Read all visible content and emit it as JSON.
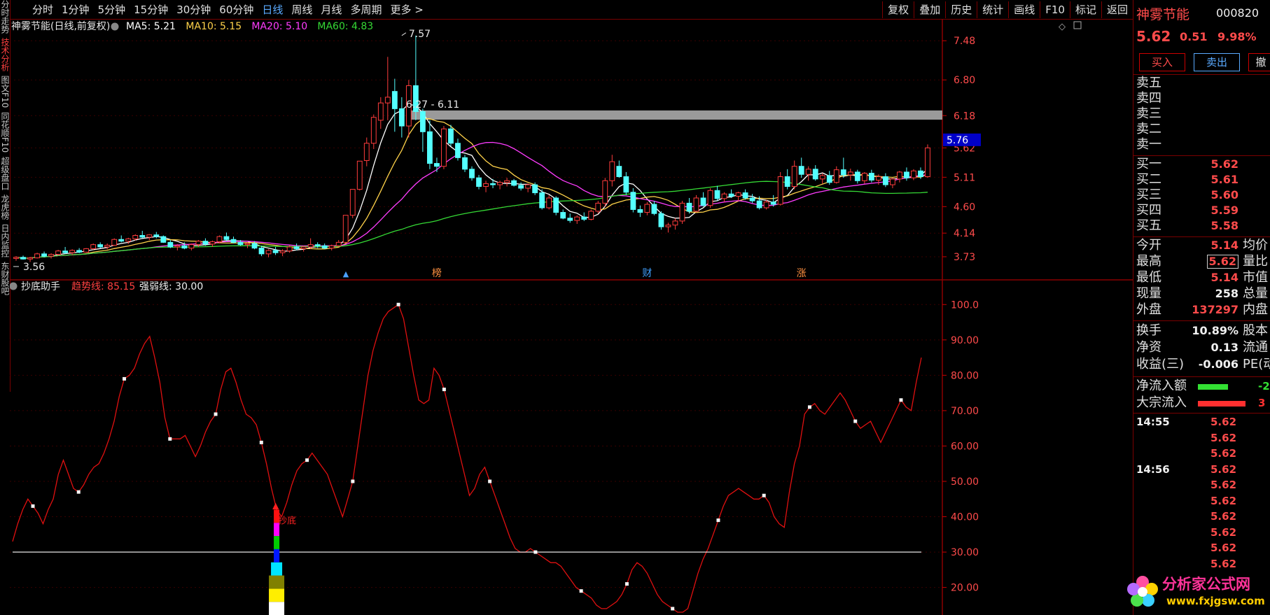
{
  "toolbar": {
    "periods": [
      "分时",
      "1分钟",
      "5分钟",
      "15分钟",
      "30分钟",
      "60分钟",
      "日线",
      "周线",
      "月线",
      "多周期",
      "更多 >"
    ],
    "active_period": "日线",
    "tools": [
      "复权",
      "叠加",
      "历史",
      "统计",
      "画线",
      "F10",
      "标记",
      "返回"
    ]
  },
  "side_tabs": [
    "分时走势",
    "技术分析",
    "图文F10",
    "同花顺F10",
    "超级盘口",
    "龙虎榜",
    "日内监控",
    "东财股吧"
  ],
  "header": {
    "stock_title": "神雾节能(日线,前复权)",
    "ma": [
      {
        "label": "MA5: 5.21",
        "color": "#ffffff"
      },
      {
        "label": "MA10: 5.15",
        "color": "#ffd24a"
      },
      {
        "label": "MA20: 5.10",
        "color": "#ff3cff"
      },
      {
        "label": "MA60: 4.83",
        "color": "#35d935"
      }
    ]
  },
  "indicator_header": {
    "name": "抄底助手",
    "trend": "趋势线: 85.15",
    "strength": "强弱线: 30.00"
  },
  "chart_data": [
    {
      "type": "candlestick",
      "title": "神雾节能(日线,前复权)",
      "ylim": [
        3.45,
        7.75
      ],
      "y_ticks": [
        7.48,
        6.8,
        6.18,
        5.62,
        5.11,
        4.6,
        4.14,
        3.73
      ],
      "current_price_label": "5.76",
      "annotations": [
        {
          "text": "7.57",
          "index": 55,
          "price": 7.57
        },
        {
          "text": "6.27 - 6.11",
          "index": 56,
          "price": 6.27
        },
        {
          "text": "3.56",
          "index": 0,
          "price": 3.56
        }
      ],
      "resistance_band": {
        "from": 6.11,
        "to": 6.27,
        "start_index": 56
      },
      "event_markers": [
        {
          "text": "榜",
          "index": 60,
          "color": "#ff9040"
        },
        {
          "text": "财",
          "index": 90,
          "color": "#40a0ff"
        },
        {
          "text": "涨",
          "index": 112,
          "color": "#ff9040"
        }
      ],
      "candles": [
        [
          3.7,
          3.74,
          3.66,
          3.72
        ],
        [
          3.72,
          3.75,
          3.68,
          3.69
        ],
        [
          3.69,
          3.73,
          3.64,
          3.71
        ],
        [
          3.71,
          3.8,
          3.7,
          3.78
        ],
        [
          3.78,
          3.82,
          3.72,
          3.74
        ],
        [
          3.74,
          3.79,
          3.7,
          3.77
        ],
        [
          3.77,
          3.85,
          3.75,
          3.83
        ],
        [
          3.83,
          3.9,
          3.78,
          3.8
        ],
        [
          3.8,
          3.86,
          3.76,
          3.84
        ],
        [
          3.84,
          3.88,
          3.79,
          3.81
        ],
        [
          3.81,
          3.88,
          3.8,
          3.87
        ],
        [
          3.87,
          3.96,
          3.85,
          3.94
        ],
        [
          3.94,
          3.98,
          3.88,
          3.9
        ],
        [
          3.9,
          3.96,
          3.86,
          3.93
        ],
        [
          3.93,
          4.05,
          3.92,
          4.03
        ],
        [
          4.03,
          4.1,
          3.98,
          4.0
        ],
        [
          4.0,
          4.06,
          3.95,
          4.04
        ],
        [
          4.04,
          4.12,
          4.01,
          4.1
        ],
        [
          4.1,
          4.18,
          4.05,
          4.07
        ],
        [
          4.07,
          4.12,
          4.02,
          4.11
        ],
        [
          4.11,
          4.16,
          4.05,
          4.08
        ],
        [
          4.08,
          4.1,
          3.97,
          3.98
        ],
        [
          3.98,
          4.02,
          3.88,
          3.9
        ],
        [
          3.9,
          3.95,
          3.84,
          3.92
        ],
        [
          3.92,
          3.98,
          3.86,
          3.88
        ],
        [
          3.88,
          3.96,
          3.84,
          3.94
        ],
        [
          3.94,
          4.02,
          3.9,
          4.0
        ],
        [
          4.0,
          4.05,
          3.92,
          3.95
        ],
        [
          3.95,
          4.01,
          3.9,
          3.99
        ],
        [
          3.99,
          4.1,
          3.96,
          4.08
        ],
        [
          4.08,
          4.15,
          4.0,
          4.03
        ],
        [
          4.03,
          4.08,
          3.96,
          3.98
        ],
        [
          3.98,
          4.02,
          3.92,
          3.94
        ],
        [
          3.94,
          3.98,
          3.88,
          3.96
        ],
        [
          3.96,
          4.0,
          3.86,
          3.88
        ],
        [
          3.88,
          3.92,
          3.74,
          3.78
        ],
        [
          3.78,
          3.86,
          3.72,
          3.84
        ],
        [
          3.84,
          3.9,
          3.76,
          3.8
        ],
        [
          3.8,
          3.86,
          3.74,
          3.83
        ],
        [
          3.83,
          3.93,
          3.8,
          3.9
        ],
        [
          3.9,
          3.96,
          3.84,
          3.87
        ],
        [
          3.87,
          3.92,
          3.82,
          3.9
        ],
        [
          3.9,
          4.05,
          3.86,
          3.94
        ],
        [
          3.94,
          3.98,
          3.88,
          3.92
        ],
        [
          3.92,
          3.96,
          3.86,
          3.88
        ],
        [
          3.88,
          3.94,
          3.84,
          3.92
        ],
        [
          3.92,
          4.02,
          3.9,
          3.98
        ],
        [
          3.98,
          4.45,
          3.97,
          4.45
        ],
        [
          4.45,
          4.9,
          4.4,
          4.9
        ],
        [
          4.9,
          5.39,
          4.88,
          5.39
        ],
        [
          5.4,
          5.8,
          5.3,
          5.7
        ],
        [
          5.7,
          6.2,
          5.6,
          6.15
        ],
        [
          6.1,
          6.5,
          5.95,
          6.4
        ],
        [
          6.4,
          7.2,
          6.1,
          6.5
        ],
        [
          6.6,
          6.82,
          5.9,
          6.3
        ],
        [
          6.3,
          6.5,
          5.8,
          6.0
        ],
        [
          6.0,
          6.8,
          5.8,
          6.7
        ],
        [
          6.7,
          7.57,
          6.1,
          6.25
        ],
        [
          6.25,
          6.3,
          5.55,
          5.9
        ],
        [
          5.9,
          6.1,
          5.25,
          5.35
        ],
        [
          5.35,
          5.45,
          5.2,
          5.3
        ],
        [
          5.3,
          6.0,
          5.25,
          5.95
        ],
        [
          5.95,
          6.02,
          5.65,
          5.7
        ],
        [
          5.7,
          5.78,
          5.4,
          5.45
        ],
        [
          5.45,
          5.5,
          5.2,
          5.25
        ],
        [
          5.25,
          5.3,
          5.05,
          5.1
        ],
        [
          5.1,
          5.15,
          4.9,
          4.95
        ],
        [
          4.95,
          5.05,
          4.85,
          5.0
        ],
        [
          5.0,
          5.08,
          4.92,
          4.98
        ],
        [
          4.98,
          5.05,
          4.9,
          5.02
        ],
        [
          5.02,
          5.1,
          4.95,
          5.05
        ],
        [
          5.05,
          5.08,
          4.95,
          4.97
        ],
        [
          4.97,
          5.02,
          4.88,
          4.92
        ],
        [
          4.92,
          5.0,
          4.85,
          4.98
        ],
        [
          4.98,
          5.02,
          4.8,
          4.84
        ],
        [
          4.84,
          4.9,
          4.55,
          4.58
        ],
        [
          4.58,
          4.8,
          4.55,
          4.75
        ],
        [
          4.75,
          4.78,
          4.45,
          4.5
        ],
        [
          4.5,
          4.55,
          4.38,
          4.4
        ],
        [
          4.4,
          4.48,
          4.32,
          4.36
        ],
        [
          4.36,
          4.45,
          4.3,
          4.42
        ],
        [
          4.42,
          4.5,
          4.35,
          4.38
        ],
        [
          4.38,
          4.55,
          4.36,
          4.52
        ],
        [
          4.52,
          4.7,
          4.48,
          4.66
        ],
        [
          4.66,
          5.1,
          4.6,
          5.05
        ],
        [
          5.05,
          5.5,
          4.95,
          5.38
        ],
        [
          5.3,
          5.4,
          5.1,
          5.12
        ],
        [
          5.12,
          5.2,
          4.8,
          4.85
        ],
        [
          4.85,
          4.92,
          4.5,
          4.55
        ],
        [
          4.55,
          4.62,
          4.42,
          4.5
        ],
        [
          4.5,
          4.68,
          4.45,
          4.64
        ],
        [
          4.64,
          4.7,
          4.45,
          4.48
        ],
        [
          4.48,
          4.52,
          4.2,
          4.25
        ],
        [
          4.25,
          4.32,
          4.15,
          4.28
        ],
        [
          4.28,
          4.4,
          4.2,
          4.35
        ],
        [
          4.35,
          4.7,
          4.3,
          4.66
        ],
        [
          4.66,
          4.75,
          4.48,
          4.52
        ],
        [
          4.52,
          4.8,
          4.5,
          4.75
        ],
        [
          4.75,
          4.85,
          4.6,
          4.62
        ],
        [
          4.62,
          4.92,
          4.58,
          4.88
        ],
        [
          4.88,
          4.96,
          4.7,
          4.74
        ],
        [
          4.74,
          4.85,
          4.68,
          4.82
        ],
        [
          4.82,
          4.9,
          4.75,
          4.78
        ],
        [
          4.78,
          4.86,
          4.7,
          4.84
        ],
        [
          4.84,
          4.9,
          4.72,
          4.75
        ],
        [
          4.75,
          4.82,
          4.66,
          4.7
        ],
        [
          4.7,
          4.78,
          4.55,
          4.58
        ],
        [
          4.58,
          4.72,
          4.55,
          4.68
        ],
        [
          4.68,
          4.8,
          4.6,
          4.64
        ],
        [
          4.64,
          5.2,
          4.62,
          5.12
        ],
        [
          5.12,
          5.25,
          4.9,
          4.95
        ],
        [
          4.95,
          5.4,
          4.9,
          5.3
        ],
        [
          5.3,
          5.45,
          5.1,
          5.16
        ],
        [
          5.16,
          5.3,
          5.05,
          5.25
        ],
        [
          5.25,
          5.32,
          5.05,
          5.08
        ],
        [
          5.08,
          5.18,
          5.0,
          5.14
        ],
        [
          5.14,
          5.22,
          4.98,
          5.02
        ],
        [
          5.02,
          5.3,
          5.0,
          5.24
        ],
        [
          5.24,
          5.45,
          5.1,
          5.15
        ],
        [
          5.15,
          5.26,
          5.05,
          5.2
        ],
        [
          5.2,
          5.24,
          5.0,
          5.05
        ],
        [
          5.05,
          5.2,
          5.0,
          5.18
        ],
        [
          5.18,
          5.24,
          5.02,
          5.06
        ],
        [
          5.06,
          5.16,
          4.98,
          5.12
        ],
        [
          5.12,
          5.18,
          4.94,
          4.98
        ],
        [
          4.98,
          5.1,
          4.92,
          5.08
        ],
        [
          5.08,
          5.22,
          5.02,
          5.2
        ],
        [
          5.2,
          5.28,
          5.05,
          5.1
        ],
        [
          5.1,
          5.25,
          5.06,
          5.22
        ],
        [
          5.22,
          5.28,
          5.08,
          5.12
        ],
        [
          5.12,
          5.68,
          5.1,
          5.62
        ]
      ]
    },
    {
      "type": "line",
      "title": "抄底助手",
      "ylim": [
        13,
        105
      ],
      "y_ticks": [
        100.0,
        90.0,
        80.0,
        70.0,
        60.0,
        50.0,
        40.0,
        30.0,
        20.0
      ],
      "series": [
        {
          "name": "趋势线",
          "color": "#e01010",
          "values": [
            33,
            38,
            42,
            45,
            43,
            41,
            38,
            42,
            45,
            52,
            56,
            52,
            48,
            47,
            49,
            52,
            54,
            55,
            58,
            62,
            67,
            74,
            79,
            80,
            82,
            86,
            89,
            91,
            85,
            78,
            68,
            62,
            62,
            62,
            63,
            60,
            57,
            60,
            64,
            67,
            69,
            76,
            81,
            82,
            78,
            73,
            69,
            68,
            66,
            61,
            55,
            48,
            42,
            40,
            44,
            49,
            53,
            55,
            56,
            58,
            56,
            54,
            52,
            48,
            44,
            40,
            45,
            50,
            60,
            70,
            80,
            87,
            92,
            96,
            98,
            99,
            100,
            96,
            88,
            80,
            73,
            72,
            73,
            82,
            80,
            76,
            70,
            64,
            58,
            52,
            46,
            48,
            52,
            54,
            50,
            46,
            42,
            38,
            34,
            31,
            30,
            30,
            31,
            30,
            29,
            28,
            27,
            27,
            26,
            24,
            22,
            20,
            19,
            18,
            17,
            15,
            14,
            14,
            15,
            16,
            18,
            21,
            25,
            27,
            26,
            24,
            21,
            18,
            16,
            15,
            14,
            13,
            13,
            14,
            19,
            24,
            28,
            31,
            35,
            39,
            43,
            46,
            47,
            48,
            47,
            46,
            45,
            45,
            46,
            44,
            40,
            38,
            37,
            47,
            55,
            60,
            69,
            71,
            72,
            70,
            69,
            71,
            73,
            75,
            73,
            70,
            67,
            65,
            66,
            67,
            64,
            61,
            64,
            67,
            70,
            73,
            71,
            70,
            78,
            85
          ]
        },
        {
          "name": "强弱线",
          "color": "#ffffff",
          "values": [
            30
          ]
        }
      ],
      "signal": {
        "index": 52,
        "text": "抄底",
        "colors": [
          "#ffffff",
          "#ffee00",
          "#808000",
          "#00e5ff",
          "#0018ff",
          "#00cc00",
          "#ff00ff",
          "#ff1010"
        ]
      }
    }
  ],
  "panel": {
    "name": "神雾节能",
    "code": "000820",
    "price": "5.62",
    "change": "0.51",
    "pct": "9.98%",
    "buttons": [
      "买入",
      "卖出",
      "撤"
    ],
    "sell_levels": [
      "卖五",
      "卖四",
      "卖三",
      "卖二",
      "卖一"
    ],
    "buy_levels": [
      {
        "label": "买一",
        "value": "5.62"
      },
      {
        "label": "买二",
        "value": "5.61"
      },
      {
        "label": "买三",
        "value": "5.60"
      },
      {
        "label": "买四",
        "value": "5.59"
      },
      {
        "label": "买五",
        "value": "5.58"
      }
    ],
    "stats_a": [
      {
        "label": "今开",
        "value": "5.14",
        "label2": "均价",
        "color": "#ff4b4b"
      },
      {
        "label": "最高",
        "value": "5.62",
        "label2": "量比",
        "color": "#ff4b4b",
        "boxed": true
      },
      {
        "label": "最低",
        "value": "5.14",
        "label2": "市值",
        "color": "#ff4b4b"
      },
      {
        "label": "现量",
        "value": "258",
        "label2": "总量",
        "color": "#f0f0f0"
      },
      {
        "label": "外盘",
        "value": "137297",
        "label2": "内盘",
        "color": "#ff4b4b"
      }
    ],
    "stats_b": [
      {
        "label": "换手",
        "value": "10.89%",
        "label2": "股本"
      },
      {
        "label": "净资",
        "value": "0.13",
        "label2": "流通"
      },
      {
        "label": "收益(三)",
        "value": "-0.006",
        "label2": "PE(动"
      }
    ],
    "flows": [
      {
        "label": "净流入额",
        "value": "-2",
        "color": "#33e033",
        "bar": 0.6
      },
      {
        "label": "大宗流入",
        "value": "3",
        "color": "#ff3030",
        "bar": 0.95
      }
    ],
    "ticks": [
      {
        "time": "14:55",
        "price": "5.62"
      },
      {
        "time": "",
        "price": "5.62"
      },
      {
        "time": "",
        "price": "5.62"
      },
      {
        "time": "14:56",
        "price": "5.62"
      },
      {
        "time": "",
        "price": "5.62"
      },
      {
        "time": "",
        "price": "5.62"
      },
      {
        "time": "",
        "price": "5.62"
      },
      {
        "time": "",
        "price": "5.62"
      },
      {
        "time": "",
        "price": "5.62"
      },
      {
        "time": "",
        "price": "5.62"
      }
    ]
  },
  "logo": {
    "name": "分析家公式网",
    "url": "www.fxjgsw.com"
  }
}
